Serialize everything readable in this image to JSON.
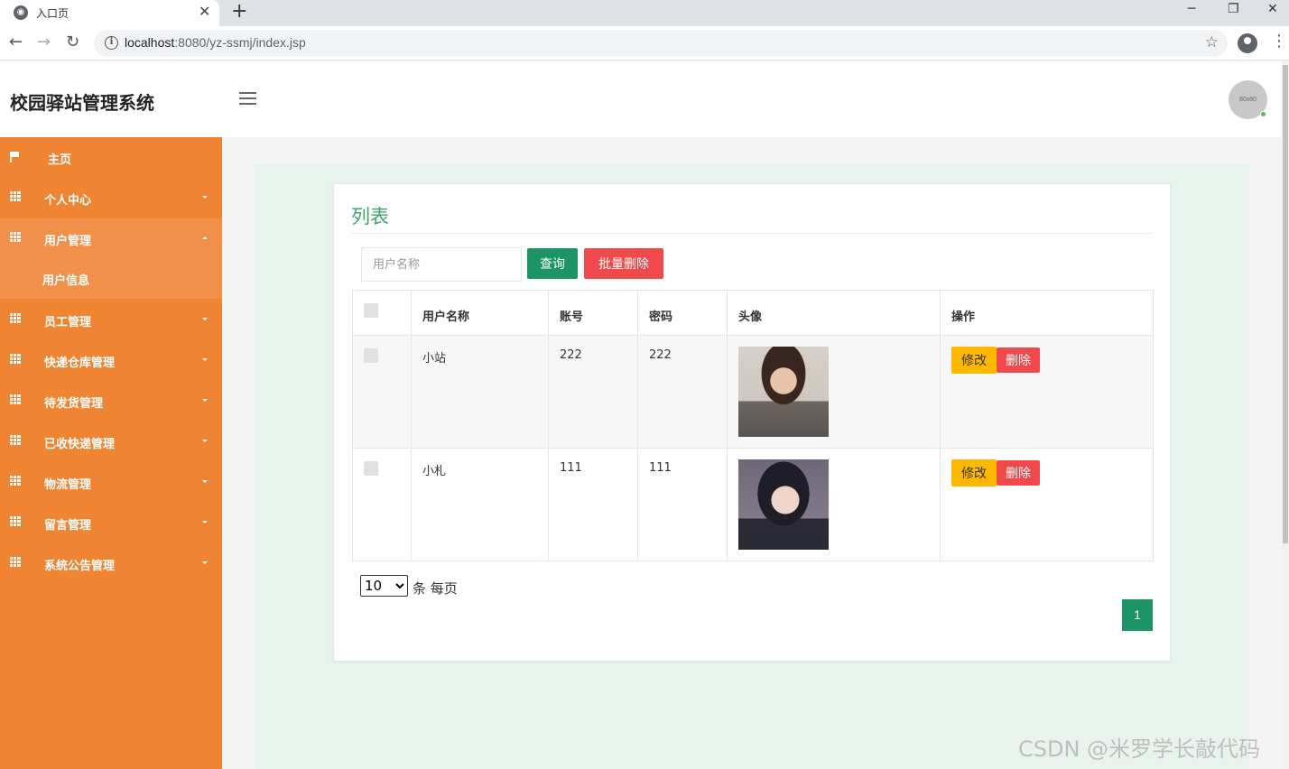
{
  "browser": {
    "tab_title": "入口页",
    "tab_close": "✕",
    "newtab": "+",
    "url_host": "localhost",
    "url_rest": ":8080/yz-ssmj/index.jsp",
    "icons": [
      "globe-icon",
      "close-icon",
      "plus-icon",
      "back-icon",
      "forward-icon",
      "reload-icon",
      "info-icon",
      "star-icon",
      "profile-icon",
      "kebab-menu-icon"
    ]
  },
  "header": {
    "app_title": "校园驿站管理系统",
    "avatar_text": "80x80"
  },
  "sidebar": {
    "items": [
      {
        "label": "主页",
        "icon": "flag-icon"
      },
      {
        "label": "个人中心",
        "icon": "grid-icon",
        "expanded": false
      },
      {
        "label": "用户管理",
        "icon": "grid-icon",
        "expanded": true
      },
      {
        "label": "员工管理",
        "icon": "grid-icon",
        "expanded": false
      },
      {
        "label": "快递仓库管理",
        "icon": "grid-icon",
        "expanded": false
      },
      {
        "label": "待发货管理",
        "icon": "grid-icon",
        "expanded": false
      },
      {
        "label": "已收快递管理",
        "icon": "grid-icon",
        "expanded": false
      },
      {
        "label": "物流管理",
        "icon": "grid-icon",
        "expanded": false
      },
      {
        "label": "留言管理",
        "icon": "grid-icon",
        "expanded": false
      },
      {
        "label": "系统公告管理",
        "icon": "grid-icon",
        "expanded": false
      }
    ],
    "sub_item": "用户信息",
    "colors": {
      "background": "#ef8533",
      "active": "#f0904a"
    }
  },
  "main": {
    "card_title": "列表",
    "search_placeholder": "用户名称",
    "query_label": "查询",
    "batch_delete_label": "批量删除",
    "table": {
      "headers": [
        "",
        "用户名称",
        "账号",
        "密码",
        "头像",
        "操作"
      ],
      "rows": [
        {
          "name": "小站",
          "account": "222",
          "password": "222",
          "avatar": "photo-portrait-1"
        },
        {
          "name": "小札",
          "account": "111",
          "password": "111",
          "avatar": "photo-portrait-2"
        }
      ],
      "edit_label": "修改",
      "delete_label": "删除"
    },
    "page_size": "10",
    "page_size_suffix": "条 每页",
    "current_page": "1",
    "colors": {
      "accent": "#1d9466",
      "title": "#3ea36e",
      "danger": "#f0494b",
      "warn": "#ffb800"
    }
  },
  "watermark": "CSDN @米罗学长敲代码"
}
